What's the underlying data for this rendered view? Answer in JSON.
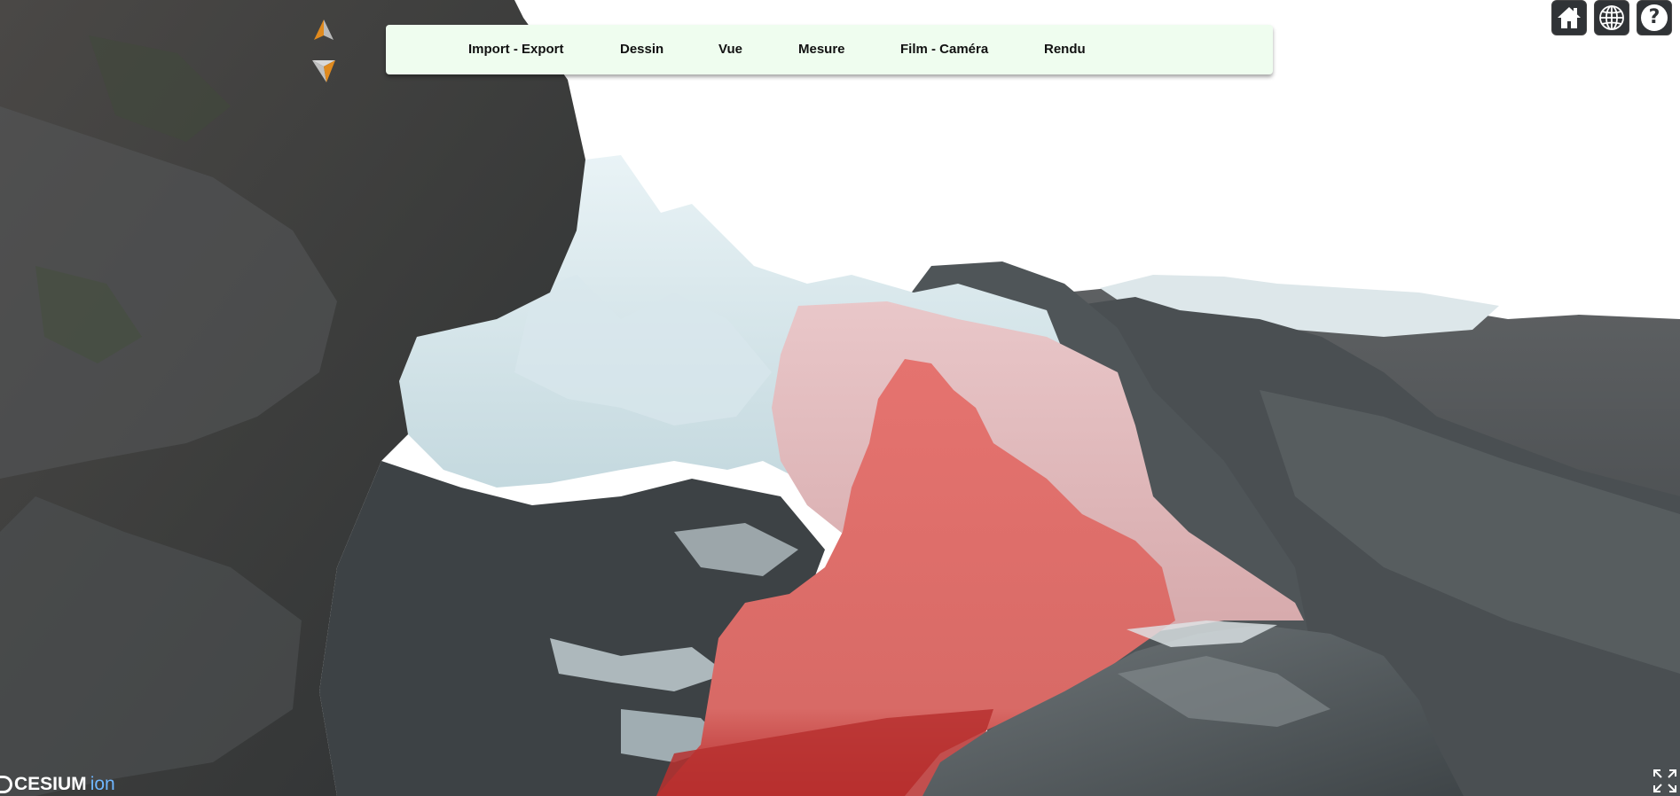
{
  "menu": {
    "items": [
      {
        "id": "import-export",
        "label": "Import - Export"
      },
      {
        "id": "dessin",
        "label": "Dessin"
      },
      {
        "id": "vue",
        "label": "Vue"
      },
      {
        "id": "mesure",
        "label": "Mesure"
      },
      {
        "id": "film-camera",
        "label": "Film - Caméra"
      },
      {
        "id": "rendu",
        "label": "Rendu"
      }
    ]
  },
  "toolbar": {
    "home_icon": "home-icon",
    "globe_icon": "globe-icon",
    "help_icon": "help-icon",
    "help_glyph": "?"
  },
  "credits": {
    "brand": "CESIUM",
    "product": "ion"
  },
  "colors": {
    "menu_bg": "#effdef",
    "button_bg": "#303336",
    "highlight_red": "#e06060",
    "highlight_pink": "#e8c8cc",
    "ion_blue": "#6fb6ff"
  }
}
